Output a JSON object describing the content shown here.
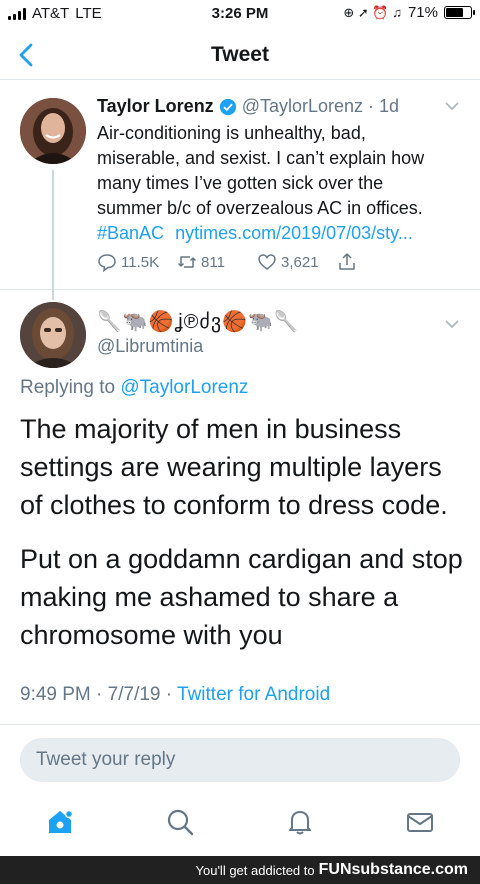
{
  "status_bar": {
    "carrier": "AT&T",
    "network": "LTE",
    "time": "3:26 PM",
    "icons": "⊕ ➚ ⏰ ♫",
    "battery_percent": "71%",
    "battery_level": 0.71
  },
  "nav": {
    "title": "Tweet"
  },
  "tweet": {
    "name": "Taylor Lorenz",
    "handle": "@TaylorLorenz",
    "separator": "·",
    "age": "1d",
    "text_lines": [
      "Air-conditioning is unhealthy, bad,",
      "miserable, and sexist. I can’t explain how",
      "many times I’ve gotten sick over the",
      "summer b/c of overzealous AC in offices."
    ],
    "hashtag": "#BanAC",
    "link": "nytimes.com/2019/07/03/sty...",
    "replies": "11.5K",
    "retweets": "811",
    "likes": "3,621"
  },
  "reply": {
    "display_name": "🥄🐃🏀ʝ℗ძვ🏀🐃🥄",
    "handle": "@Librumtinia",
    "replying_prefix": "Replying to",
    "replying_to": "@TaylorLorenz",
    "paragraph1": "The majority of men in business settings are wearing multiple layers of clothes to conform to dress code.",
    "paragraph2": "Put on a goddamn cardigan and stop making me ashamed to share a chromosome with you",
    "time": "9:49 PM",
    "date": "7/7/19",
    "source": "Twitter for Android"
  },
  "composer": {
    "placeholder": "Tweet your reply"
  },
  "banner": {
    "text": "You'll get addicted to",
    "brand": "FUNsubstance.com"
  },
  "colors": {
    "accent": "#1da1f2",
    "secondary_text": "#657786",
    "reply_box_bg": "#e6ecf0"
  }
}
